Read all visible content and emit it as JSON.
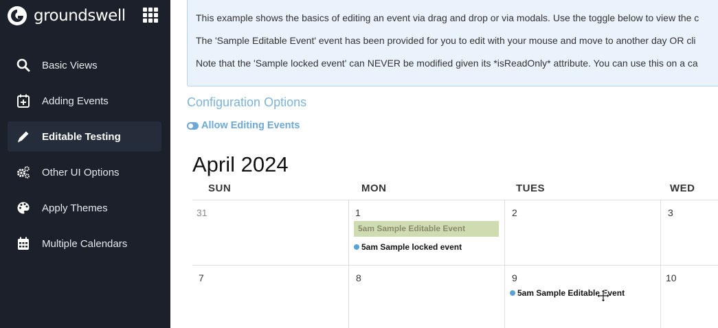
{
  "brand": {
    "name": "groundswell"
  },
  "sidebar": {
    "items": [
      {
        "label": "Basic Views",
        "icon": "search-icon",
        "active": false
      },
      {
        "label": "Adding Events",
        "icon": "calendar-plus-icon",
        "active": false
      },
      {
        "label": "Editable Testing",
        "icon": "pencil-icon",
        "active": true
      },
      {
        "label": "Other UI Options",
        "icon": "gears-icon",
        "active": false
      },
      {
        "label": "Apply Themes",
        "icon": "palette-icon",
        "active": false
      },
      {
        "label": "Multiple Calendars",
        "icon": "calendar-grid-icon",
        "active": false
      }
    ]
  },
  "info": {
    "line1": "This example shows the basics of editing an event via drag and drop or via modals. Use the toggle below to view the c",
    "line2": "The 'Sample Editable Event' event has been provided for you to edit with your mouse and move to another day OR cli",
    "line3": "Note that the 'Sample locked event' can NEVER be modified given its *isReadOnly* attribute. You can use this on a ca"
  },
  "config": {
    "title": "Configuration Options",
    "toggle_label": "Allow Editing Events",
    "toggle_on": true
  },
  "calendar": {
    "month_title": "April 2024",
    "day_headers": [
      "SUN",
      "MON",
      "TUES",
      "WED"
    ],
    "week1": [
      "31",
      "1",
      "2",
      "3"
    ],
    "week2": [
      "7",
      "8",
      "9",
      "10"
    ],
    "events": {
      "editable_week1": "5am Sample Editable Event",
      "locked_week1": "5am Sample locked event",
      "editable_week2": "5am Sample Editable Event"
    }
  },
  "colors": {
    "sidebar_bg": "#1b202a",
    "accent": "#6ea8d6",
    "event_dot": "#5aa2d6",
    "editable_event_bg": "#cfdcb2"
  }
}
